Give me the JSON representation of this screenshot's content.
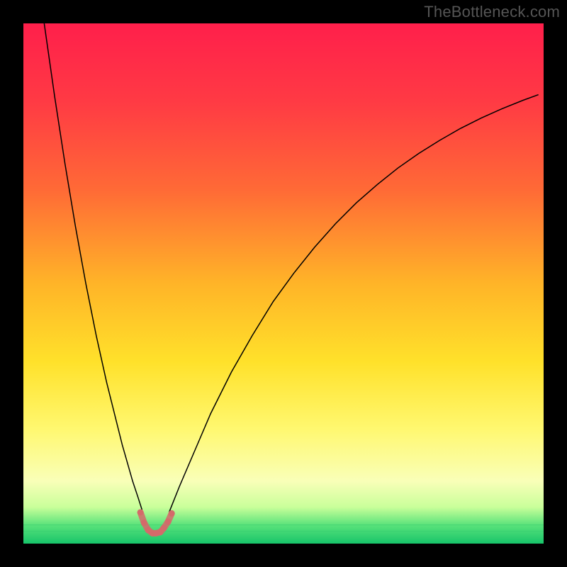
{
  "watermark": "TheBottleneck.com",
  "chart_data": {
    "type": "line",
    "title": "",
    "xlabel": "",
    "ylabel": "",
    "xlim": [
      0,
      100
    ],
    "ylim": [
      0,
      100
    ],
    "grid": false,
    "legend": false,
    "background_gradient_stops": [
      {
        "offset": 0.0,
        "color": "#ff1f4b"
      },
      {
        "offset": 0.15,
        "color": "#ff3a44"
      },
      {
        "offset": 0.32,
        "color": "#ff6a36"
      },
      {
        "offset": 0.5,
        "color": "#ffb428"
      },
      {
        "offset": 0.65,
        "color": "#ffe12a"
      },
      {
        "offset": 0.78,
        "color": "#fff870"
      },
      {
        "offset": 0.88,
        "color": "#f9ffb8"
      },
      {
        "offset": 0.93,
        "color": "#c9ff9a"
      },
      {
        "offset": 0.965,
        "color": "#58e27a"
      },
      {
        "offset": 1.0,
        "color": "#17c56a"
      }
    ],
    "series": [
      {
        "name": "curve-left",
        "stroke": "#000000",
        "stroke_width": 1.5,
        "x": [
          4,
          5,
          6,
          7,
          8,
          9,
          10,
          11,
          12,
          13,
          14,
          15,
          16,
          17,
          18,
          19,
          20,
          21,
          22,
          22.8
        ],
        "y": [
          100,
          93,
          86,
          79.5,
          73,
          67,
          61,
          55.5,
          50,
          45,
          40,
          35.5,
          31,
          27,
          23,
          19,
          15.5,
          12,
          9,
          6.5
        ]
      },
      {
        "name": "curve-right",
        "stroke": "#000000",
        "stroke_width": 1.5,
        "x": [
          28,
          30,
          33,
          36,
          40,
          44,
          48,
          52,
          56,
          60,
          64,
          68,
          72,
          76,
          80,
          84,
          88,
          92,
          96,
          99
        ],
        "y": [
          6,
          11,
          18,
          25,
          33,
          40,
          46.5,
          52,
          57,
          61.5,
          65.5,
          69,
          72.2,
          75,
          77.5,
          79.8,
          81.8,
          83.6,
          85.2,
          86.3
        ]
      },
      {
        "name": "trough-marker",
        "stroke": "#d46a6a",
        "stroke_width": 9,
        "style": "dotted",
        "x": [
          22.5,
          23.2,
          24.0,
          24.8,
          25.5,
          26.3,
          27.0,
          27.8,
          28.5
        ],
        "y": [
          6.0,
          4.0,
          2.6,
          2.0,
          2.0,
          2.2,
          3.0,
          4.2,
          5.8
        ]
      }
    ],
    "lower_green_lines": {
      "count": 3,
      "y_positions": [
        1.2,
        2.4,
        3.6
      ],
      "color": "#36c96f"
    }
  }
}
